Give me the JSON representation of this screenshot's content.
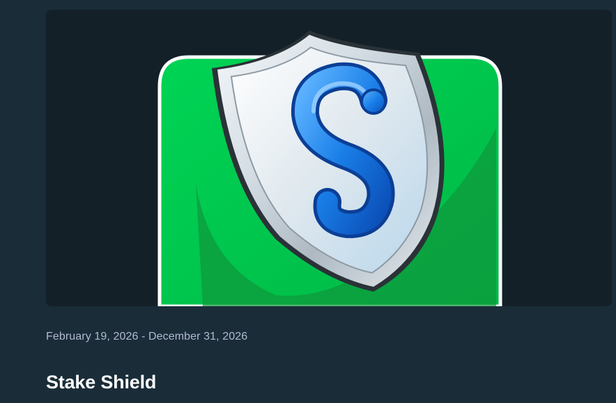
{
  "promotion": {
    "date_range": "February 19, 2026 - December 31, 2026",
    "title": "Stake Shield",
    "image": {
      "icon": "shield-s-logo-icon",
      "description_colors": {
        "tile_green": "#00c74d",
        "tile_border": "#ffffff",
        "shield_silver": "#cfd8df",
        "letter_blue": "#1a7fe8"
      }
    }
  },
  "theme": {
    "page_background": "#1a2c38",
    "card_background": "#142028",
    "secondary_text": "#b1bad3",
    "primary_text": "#ffffff"
  }
}
